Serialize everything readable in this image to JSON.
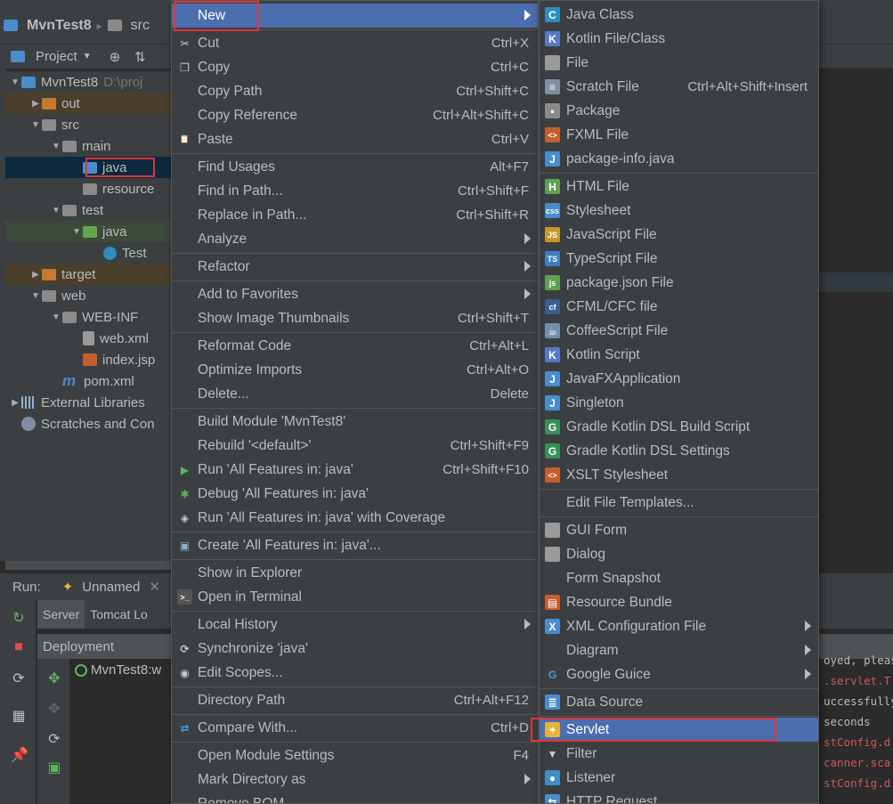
{
  "navbar": {
    "project": "MvnTest8",
    "crumb": "src"
  },
  "project_panel": {
    "title": "Project",
    "tree": [
      {
        "label": "MvnTest8",
        "path": "D:\\proj",
        "indent": 0,
        "arrow": "down",
        "icon": "module"
      },
      {
        "label": "out",
        "indent": 1,
        "arrow": "right",
        "icon": "folder-orange",
        "style": "excluded"
      },
      {
        "label": "src",
        "indent": 1,
        "arrow": "down",
        "icon": "folder"
      },
      {
        "label": "main",
        "indent": 2,
        "arrow": "down",
        "icon": "folder"
      },
      {
        "label": "java",
        "indent": 3,
        "arrow": "",
        "icon": "folder-blue",
        "style": "selected"
      },
      {
        "label": "resource",
        "indent": 3,
        "arrow": "",
        "icon": "resource"
      },
      {
        "label": "test",
        "indent": 2,
        "arrow": "down",
        "icon": "folder"
      },
      {
        "label": "java",
        "indent": 3,
        "arrow": "down",
        "icon": "folder-green",
        "style": "testsrc"
      },
      {
        "label": "Test",
        "indent": 4,
        "arrow": "",
        "icon": "class"
      },
      {
        "label": "target",
        "indent": 1,
        "arrow": "right",
        "icon": "folder-orange",
        "style": "excluded"
      },
      {
        "label": "web",
        "indent": 1,
        "arrow": "down",
        "icon": "folder"
      },
      {
        "label": "WEB-INF",
        "indent": 2,
        "arrow": "down",
        "icon": "folder"
      },
      {
        "label": "web.xml",
        "indent": 3,
        "arrow": "",
        "icon": "xml"
      },
      {
        "label": "index.jsp",
        "indent": 3,
        "arrow": "",
        "icon": "jsp"
      },
      {
        "label": "pom.xml",
        "indent": 2,
        "arrow": "",
        "icon": "maven"
      },
      {
        "label": "External Libraries",
        "indent": 0,
        "arrow": "right",
        "icon": "library"
      },
      {
        "label": "Scratches and Con",
        "indent": 0,
        "arrow": "",
        "icon": "scratch"
      }
    ]
  },
  "run_panel": {
    "label": "Run:",
    "config": "Unnamed",
    "tabs": [
      "Server",
      "Tomcat Lo"
    ],
    "deployment_header": "Deployment",
    "deployment_item": "MvnTest8:w"
  },
  "console_lines": [
    {
      "text": "oyed, pleas",
      "kind": "norm"
    },
    {
      "text": ".servlet.T",
      "kind": "err"
    },
    {
      "text": "uccessfully",
      "kind": "norm"
    },
    {
      "text": "seconds",
      "kind": "norm"
    },
    {
      "text": "stConfig.d",
      "kind": "err"
    },
    {
      "text": "canner.sca",
      "kind": "err"
    },
    {
      "text": "stConfig.d",
      "kind": "err"
    }
  ],
  "context_menu": [
    {
      "label": "New",
      "submenu": true,
      "highlight": true
    },
    {
      "sep": true
    },
    {
      "label": "Cut",
      "shortcut": "Ctrl+X",
      "icon": "cut"
    },
    {
      "label": "Copy",
      "shortcut": "Ctrl+C",
      "icon": "copy"
    },
    {
      "label": "Copy Path",
      "shortcut": "Ctrl+Shift+C"
    },
    {
      "label": "Copy Reference",
      "shortcut": "Ctrl+Alt+Shift+C"
    },
    {
      "label": "Paste",
      "shortcut": "Ctrl+V",
      "icon": "paste"
    },
    {
      "sep": true
    },
    {
      "label": "Find Usages",
      "shortcut": "Alt+F7"
    },
    {
      "label": "Find in Path...",
      "shortcut": "Ctrl+Shift+F"
    },
    {
      "label": "Replace in Path...",
      "shortcut": "Ctrl+Shift+R"
    },
    {
      "label": "Analyze",
      "submenu": true
    },
    {
      "sep": true
    },
    {
      "label": "Refactor",
      "submenu": true
    },
    {
      "sep": true
    },
    {
      "label": "Add to Favorites",
      "submenu": true
    },
    {
      "label": "Show Image Thumbnails",
      "shortcut": "Ctrl+Shift+T"
    },
    {
      "sep": true
    },
    {
      "label": "Reformat Code",
      "shortcut": "Ctrl+Alt+L"
    },
    {
      "label": "Optimize Imports",
      "shortcut": "Ctrl+Alt+O"
    },
    {
      "label": "Delete...",
      "shortcut": "Delete"
    },
    {
      "sep": true
    },
    {
      "label": "Build Module 'MvnTest8'"
    },
    {
      "label": "Rebuild '<default>'",
      "shortcut": "Ctrl+Shift+F9"
    },
    {
      "label": "Run 'All Features in: java'",
      "shortcut": "Ctrl+Shift+F10",
      "icon": "run"
    },
    {
      "label": "Debug 'All Features in: java'",
      "icon": "debug"
    },
    {
      "label": "Run 'All Features in: java' with Coverage",
      "icon": "coverage"
    },
    {
      "sep": true
    },
    {
      "label": "Create 'All Features in: java'...",
      "icon": "create"
    },
    {
      "sep": true
    },
    {
      "label": "Show in Explorer"
    },
    {
      "label": "Open in Terminal",
      "icon": "terminal"
    },
    {
      "sep": true
    },
    {
      "label": "Local History",
      "submenu": true
    },
    {
      "label": "Synchronize 'java'",
      "icon": "sync"
    },
    {
      "label": "Edit Scopes...",
      "icon": "scopes"
    },
    {
      "sep": true
    },
    {
      "label": "Directory Path",
      "shortcut": "Ctrl+Alt+F12"
    },
    {
      "sep": true
    },
    {
      "label": "Compare With...",
      "shortcut": "Ctrl+D",
      "icon": "compare"
    },
    {
      "sep": true
    },
    {
      "label": "Open Module Settings",
      "shortcut": "F4"
    },
    {
      "label": "Mark Directory as",
      "submenu": true
    },
    {
      "label": "Remove BOM"
    }
  ],
  "new_submenu": [
    {
      "label": "Java Class",
      "icon": "java-class"
    },
    {
      "label": "Kotlin File/Class",
      "icon": "kotlin"
    },
    {
      "label": "File",
      "icon": "file"
    },
    {
      "label": "Scratch File",
      "shortcut": "Ctrl+Alt+Shift+Insert",
      "icon": "scratch"
    },
    {
      "label": "Package",
      "icon": "package"
    },
    {
      "label": "FXML File",
      "icon": "fxml"
    },
    {
      "label": "package-info.java",
      "icon": "java-file"
    },
    {
      "sep": true
    },
    {
      "label": "HTML File",
      "icon": "html"
    },
    {
      "label": "Stylesheet",
      "icon": "css"
    },
    {
      "label": "JavaScript File",
      "icon": "js"
    },
    {
      "label": "TypeScript File",
      "icon": "ts"
    },
    {
      "label": "package.json File",
      "icon": "nodejs"
    },
    {
      "label": "CFML/CFC file",
      "icon": "cfml"
    },
    {
      "label": "CoffeeScript File",
      "icon": "coffee"
    },
    {
      "label": "Kotlin Script",
      "icon": "kotlin"
    },
    {
      "label": "JavaFXApplication",
      "icon": "javafx"
    },
    {
      "label": "Singleton",
      "icon": "singleton"
    },
    {
      "label": "Gradle Kotlin DSL Build Script",
      "icon": "gradle"
    },
    {
      "label": "Gradle Kotlin DSL Settings",
      "icon": "gradle"
    },
    {
      "label": "XSLT Stylesheet",
      "icon": "xslt"
    },
    {
      "sep": true
    },
    {
      "label": "Edit File Templates..."
    },
    {
      "sep": true
    },
    {
      "label": "GUI Form",
      "icon": "gui-form"
    },
    {
      "label": "Dialog",
      "icon": "dialog"
    },
    {
      "label": "Form Snapshot"
    },
    {
      "label": "Resource Bundle",
      "icon": "bundle"
    },
    {
      "label": "XML Configuration File",
      "submenu": true,
      "icon": "xml-config"
    },
    {
      "label": "Diagram",
      "submenu": true
    },
    {
      "label": "Google Guice",
      "submenu": true,
      "icon": "google"
    },
    {
      "sep": true
    },
    {
      "label": "Data Source",
      "icon": "database"
    },
    {
      "sep": true
    },
    {
      "label": "Servlet",
      "highlight": true,
      "icon": "servlet"
    },
    {
      "label": "Filter",
      "icon": "filter"
    },
    {
      "label": "Listener",
      "icon": "listener"
    },
    {
      "label": "HTTP Request",
      "icon": "http"
    }
  ],
  "colors": {
    "menu_bg": "#3c3f41",
    "highlight": "#4b6eaf",
    "annotation_red": "#e0353b"
  }
}
